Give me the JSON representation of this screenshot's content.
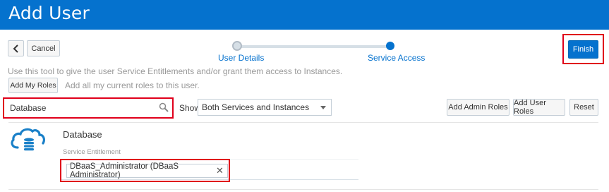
{
  "header": {
    "title": "Add User"
  },
  "toolbar": {
    "back_label": "<",
    "cancel_label": "Cancel",
    "finish_label": "Finish"
  },
  "train": {
    "steps": [
      {
        "label": "User Details"
      },
      {
        "label": "Service Access"
      }
    ]
  },
  "hint": "Use this tool to give the user Service Entitlements and/or grant them access to Instances.",
  "add_roles": {
    "button_label": "Add My Roles",
    "hint": "Add all my current roles to this user."
  },
  "search": {
    "value": "Database",
    "placeholder": ""
  },
  "filter": {
    "show_label": "Show",
    "selected": "Both Services and Instances"
  },
  "actions": {
    "admin_roles": "Add Admin Roles",
    "user_roles": "Add User Roles",
    "reset": "Reset"
  },
  "entry": {
    "title": "Database",
    "subtitle": "Service Entitlement",
    "role": "DBaaS_Administrator (DBaaS Administrator)",
    "remove_glyph": "✕"
  },
  "colors": {
    "brand": "#0572ce",
    "highlight": "#e0001b"
  },
  "icons": [
    "chevron-left-icon",
    "search-icon",
    "database-cloud-icon",
    "close-icon",
    "dropdown-arrow-icon"
  ]
}
